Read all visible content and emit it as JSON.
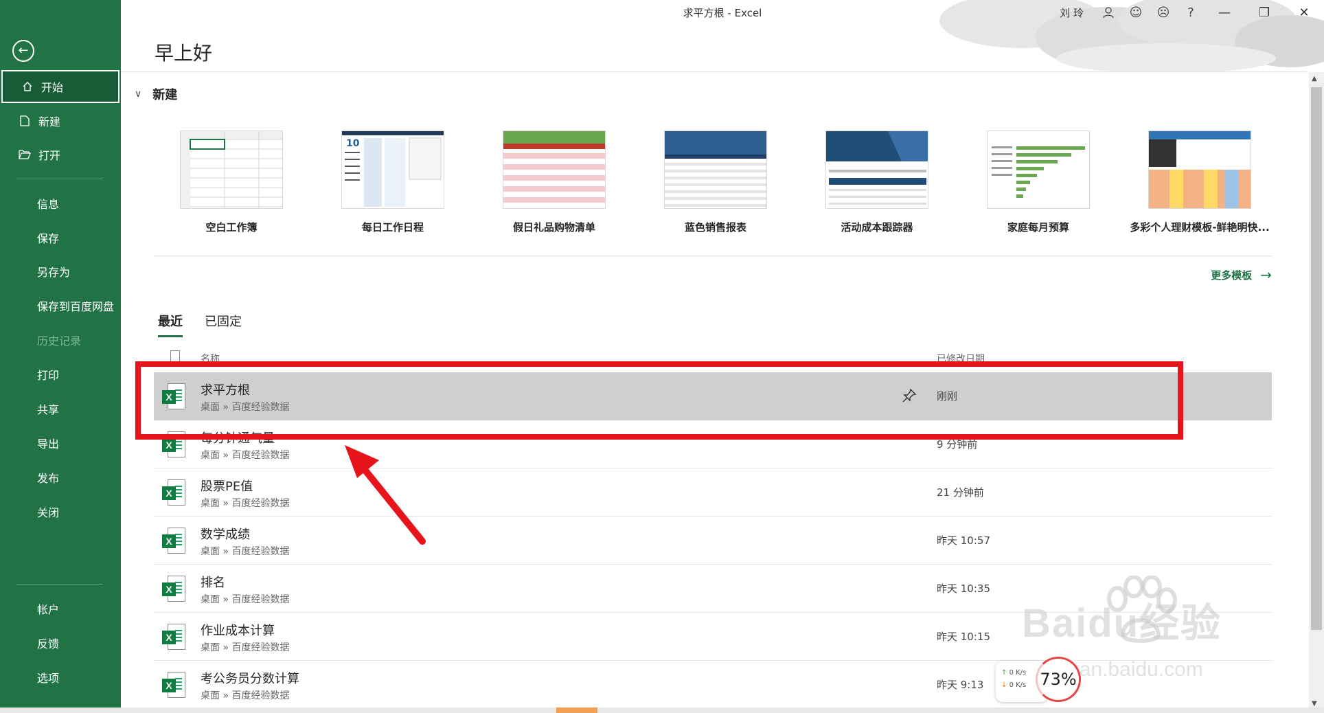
{
  "window": {
    "title": "求平方根  -  Excel",
    "username": "刘 玲"
  },
  "sidebar": {
    "items": [
      {
        "label": "开始"
      },
      {
        "label": "新建"
      },
      {
        "label": "打开"
      },
      {
        "label": "信息"
      },
      {
        "label": "保存"
      },
      {
        "label": "另存为"
      },
      {
        "label": "保存到百度网盘"
      },
      {
        "label": "历史记录"
      },
      {
        "label": "打印"
      },
      {
        "label": "共享"
      },
      {
        "label": "导出"
      },
      {
        "label": "发布"
      },
      {
        "label": "关闭"
      },
      {
        "label": "帐户"
      },
      {
        "label": "反馈"
      },
      {
        "label": "选项"
      }
    ]
  },
  "main": {
    "greeting": "早上好",
    "new_section": "新建",
    "more_templates": "更多模板",
    "templates": [
      {
        "name": "空白工作簿"
      },
      {
        "name": "每日工作日程"
      },
      {
        "name": "假日礼品购物清单"
      },
      {
        "name": "蓝色销售报表"
      },
      {
        "name": "活动成本跟踪器"
      },
      {
        "name": "家庭每月预算"
      },
      {
        "name": "多彩个人理财模板-鲜艳明快..."
      }
    ],
    "tabs": [
      {
        "label": "最近"
      },
      {
        "label": "已固定"
      }
    ],
    "list_header": {
      "name": "名称",
      "date": "已修改日期"
    },
    "files": [
      {
        "name": "求平方根",
        "path": "桌面 » 百度经验数据",
        "date": "刚刚"
      },
      {
        "name": "每分钟通气量",
        "path": "桌面 » 百度经验数据",
        "date": "9 分钟前"
      },
      {
        "name": "股票PE值",
        "path": "桌面 » 百度经验数据",
        "date": "21 分钟前"
      },
      {
        "name": "数学成绩",
        "path": "桌面 » 百度经验数据",
        "date": "昨天 10:57"
      },
      {
        "name": "排名",
        "path": "桌面 » 百度经验数据",
        "date": "昨天 10:35"
      },
      {
        "name": "作业成本计算",
        "path": "桌面 » 百度经验数据",
        "date": "昨天 10:15"
      },
      {
        "name": "考公务员分数计算",
        "path": "桌面 » 百度经验数据",
        "date": "昨天 9:13"
      }
    ]
  },
  "overlay": {
    "net_up": "0 K/s",
    "net_down": "0 K/s",
    "cpu": "73%",
    "watermark": "Baidu经验",
    "watermark_url": "jingyan.baidu.com"
  },
  "colors": {
    "accent": "#217346",
    "annotation": "#e8141c"
  }
}
